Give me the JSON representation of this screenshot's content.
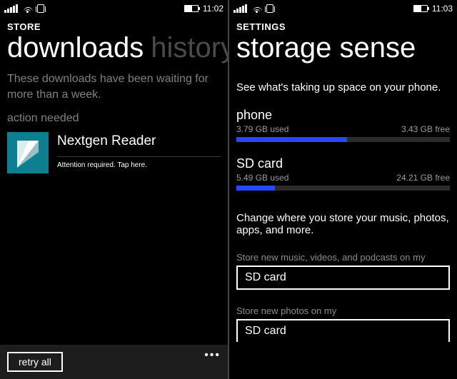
{
  "left": {
    "statusbar": {
      "batteryPct": 55,
      "time": "11:02"
    },
    "context": "STORE",
    "pivot": {
      "active": "downloads",
      "next": "history"
    },
    "waitingText": "These downloads have been waiting for more than a week.",
    "actionLabel": "action needed",
    "download": {
      "name": "Nextgen Reader",
      "status": "Attention required. Tap here."
    },
    "appbar": {
      "retry": "retry all"
    }
  },
  "right": {
    "statusbar": {
      "batteryPct": 55,
      "time": "11:03"
    },
    "context": "SETTINGS",
    "title": "storage sense",
    "description": "See what's taking up space on your phone.",
    "phone": {
      "label": "phone",
      "used": "3.79 GB used",
      "free": "3.43 GB free",
      "pct": 52
    },
    "sdcard": {
      "label": "SD card",
      "used": "5.49 GB used",
      "free": "24.21 GB free",
      "pct": 18
    },
    "changeText": "Change where you store your music, photos, apps, and more.",
    "picker1": {
      "label": "Store new music, videos, and podcasts on my",
      "value": "SD card"
    },
    "picker2": {
      "label": "Store new photos on my",
      "value": "SD card"
    }
  }
}
